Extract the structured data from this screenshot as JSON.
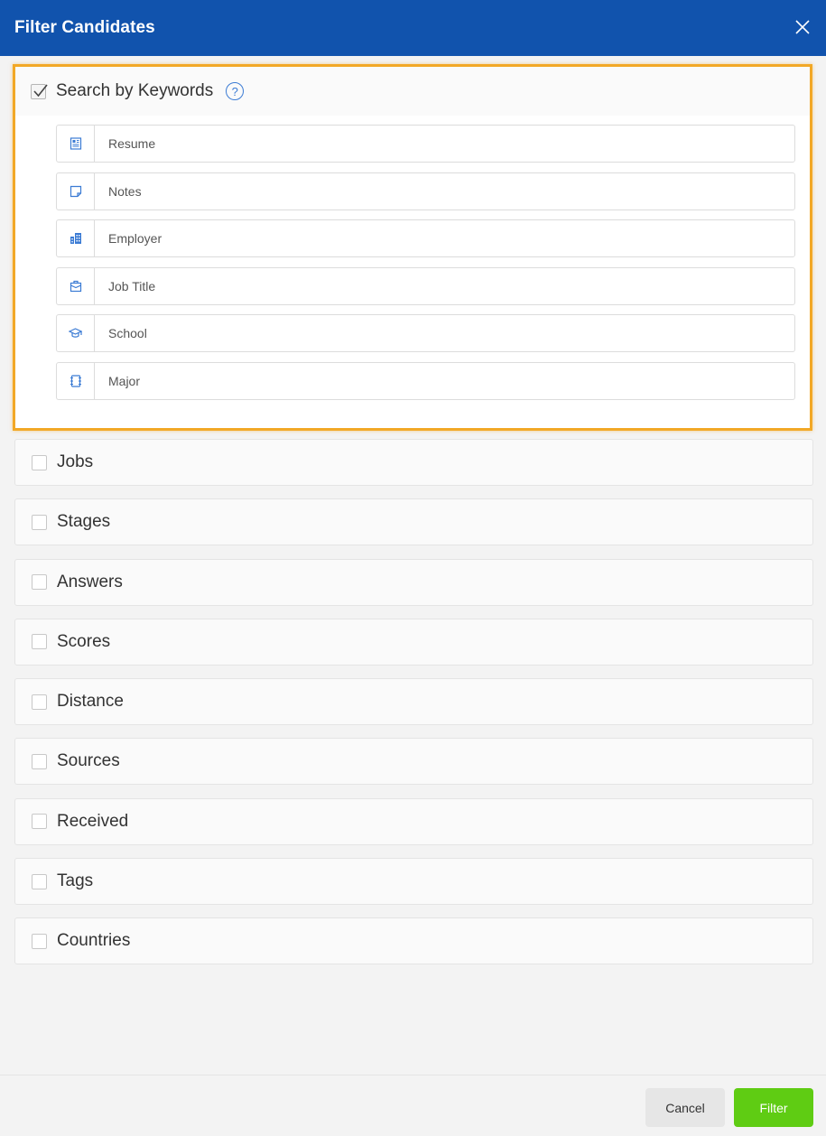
{
  "header": {
    "title": "Filter Candidates"
  },
  "keywords": {
    "label": "Search by Keywords",
    "checked": true,
    "help": "?",
    "fields": [
      {
        "placeholder": "Resume",
        "icon": "resume-icon"
      },
      {
        "placeholder": "Notes",
        "icon": "notes-icon"
      },
      {
        "placeholder": "Employer",
        "icon": "building-icon"
      },
      {
        "placeholder": "Job Title",
        "icon": "briefcase-icon"
      },
      {
        "placeholder": "School",
        "icon": "graduation-cap-icon"
      },
      {
        "placeholder": "Major",
        "icon": "notebook-icon"
      }
    ]
  },
  "filters": [
    {
      "label": "Jobs",
      "checked": false
    },
    {
      "label": "Stages",
      "checked": false
    },
    {
      "label": "Answers",
      "checked": false
    },
    {
      "label": "Scores",
      "checked": false
    },
    {
      "label": "Distance",
      "checked": false
    },
    {
      "label": "Sources",
      "checked": false
    },
    {
      "label": "Received",
      "checked": false
    },
    {
      "label": "Tags",
      "checked": false
    },
    {
      "label": "Countries",
      "checked": false
    }
  ],
  "footer": {
    "cancel_label": "Cancel",
    "filter_label": "Filter"
  },
  "colors": {
    "header": "#1153ad",
    "highlight": "#f2a826",
    "icon": "#3b7bd4",
    "filter_button": "#5fcc13"
  }
}
